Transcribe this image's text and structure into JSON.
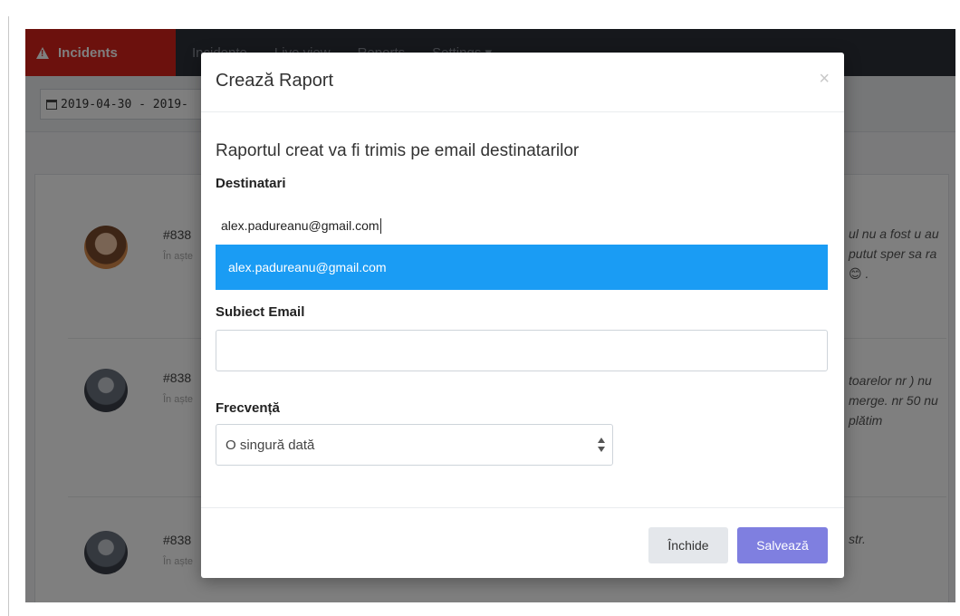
{
  "app": {
    "brand_label": "Incidents",
    "nav": [
      "Incidente",
      "Live view",
      "Reports",
      "Settings ▾"
    ],
    "date_range": "2019-04-30 - 2019-",
    "incidents": [
      {
        "number": "#838",
        "status": "În aște",
        "desc": "ul nu a fost u au putut sper sa ra😊 ."
      },
      {
        "number": "#838",
        "status": "În aște",
        "desc": "toarelor nr ) nu merge. nr 50 nu plătim"
      },
      {
        "number": "#838",
        "status": "În aște",
        "desc": "str."
      }
    ]
  },
  "modal": {
    "title": "Crează Raport",
    "close_symbol": "×",
    "intro": "Raportul creat va fi trimis pe email destinatarilor",
    "recipients_label": "Destinatari",
    "recipients_value": "alex.padureanu@gmail.com",
    "suggestion": "alex.padureanu@gmail.com",
    "subject_label": "Subiect Email",
    "subject_value": "",
    "frequency_label": "Frecvență",
    "frequency_selected": "O singură dată",
    "close_button": "Închide",
    "save_button": "Salvează"
  },
  "colors": {
    "brand_red": "#d9231b",
    "suggestion_blue": "#1a9cf4",
    "save_purple": "#7f7fe0"
  }
}
